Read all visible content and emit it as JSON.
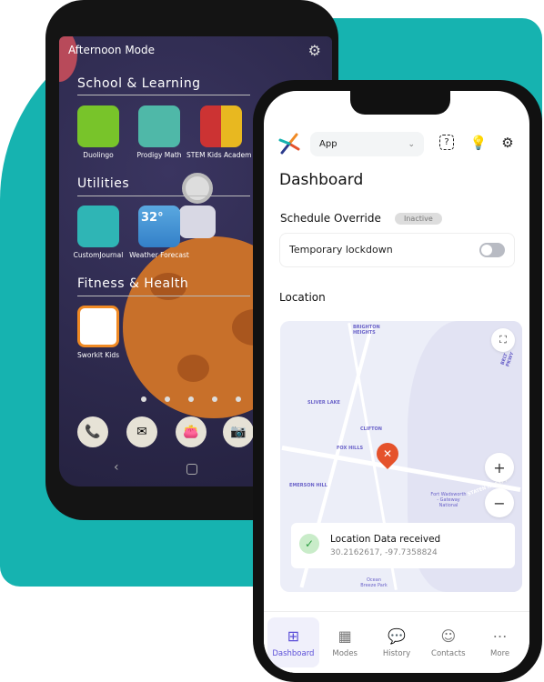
{
  "colors": {
    "teal": "#16b3b0",
    "accent": "#5b4fd8",
    "pin": "#e5522b"
  },
  "back_phone": {
    "mode_title": "Afternoon Mode",
    "sections": [
      {
        "title": "School & Learning",
        "apps": [
          "Duolingo",
          "Prodigy Math",
          "STEM Kids Academ"
        ]
      },
      {
        "title": "Utilities",
        "apps": [
          "CustomJournal",
          "Weather Forecast"
        ]
      },
      {
        "title": "Fitness & Health",
        "apps": [
          "Sworkit Kids"
        ]
      }
    ],
    "weather_temp": "32°",
    "dock": [
      "phone-icon",
      "mail-icon",
      "wallet-icon",
      "camera-icon"
    ]
  },
  "front_phone": {
    "app_select": "App",
    "header_icons": [
      "help-icon",
      "lightbulb-icon",
      "gear-icon"
    ],
    "page_title": "Dashboard",
    "schedule": {
      "title": "Schedule Override",
      "badge": "Inactive",
      "toggle_label": "Temporary lockdown",
      "toggle_on": false
    },
    "location": {
      "title": "Location",
      "status": "Location Data received",
      "coords": "30.2162617, -97.7358824",
      "map_labels": [
        "BRIGHTON HEIGHTS",
        "SLIVER LAKE",
        "CLIFTON",
        "FOX HILLS",
        "EMERSON HILL",
        "Fort Wadsworth - Gateway National",
        "Ocean Breeze Park",
        "STATEN IS. EXPY",
        "BELT PKWY"
      ]
    },
    "nav": [
      {
        "label": "Dashboard",
        "active": true
      },
      {
        "label": "Modes"
      },
      {
        "label": "History"
      },
      {
        "label": "Contacts"
      },
      {
        "label": "More"
      }
    ]
  }
}
